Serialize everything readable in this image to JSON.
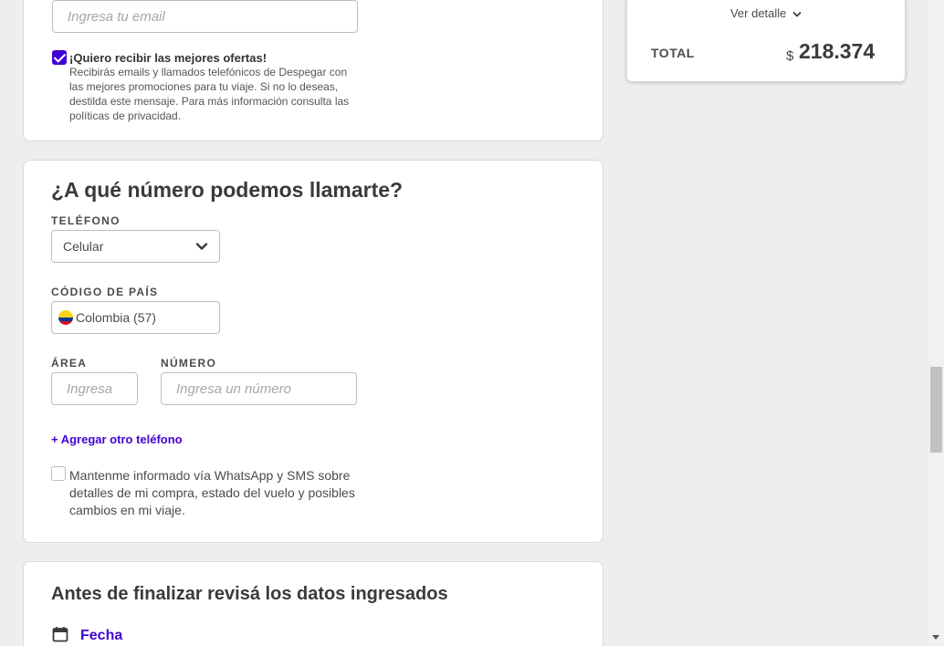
{
  "email_section": {
    "email_placeholder": "Ingresa tu email",
    "offers_label": "¡Quiero recibir las mejores ofertas!",
    "offers_description": "Recibirás emails y llamados telefónicos de Despegar con las mejores promociones para tu viaje. Si no lo deseas, destilda este mensaje. Para más información consulta las políticas de privacidad.",
    "offers_checked": true
  },
  "phone_section": {
    "title": "¿A qué número podemos llamarte?",
    "phone_label": "TELÉFONO",
    "phone_type_value": "Celular",
    "country_label": "CÓDIGO DE PAÍS",
    "country_value": "Colombia (57)",
    "area_label": "ÁREA",
    "area_placeholder": "Ingresa",
    "number_label": "NÚMERO",
    "number_placeholder": "Ingresa un número",
    "add_phone_link": "+ Agregar otro teléfono",
    "whatsapp_label": "Mantenme informado vía WhatsApp y SMS sobre detalles de mi compra, estado del vuelo y posibles cambios en mi viaje.",
    "whatsapp_checked": false
  },
  "review_section": {
    "title": "Antes de finalizar revisá los datos ingresados",
    "date_label": "Fecha"
  },
  "summary": {
    "detail_link": "Ver detalle",
    "total_label": "TOTAL",
    "currency_symbol": "$",
    "total_value": "218.374"
  },
  "colors": {
    "accent": "#4300d2",
    "background": "#eeeeee"
  }
}
